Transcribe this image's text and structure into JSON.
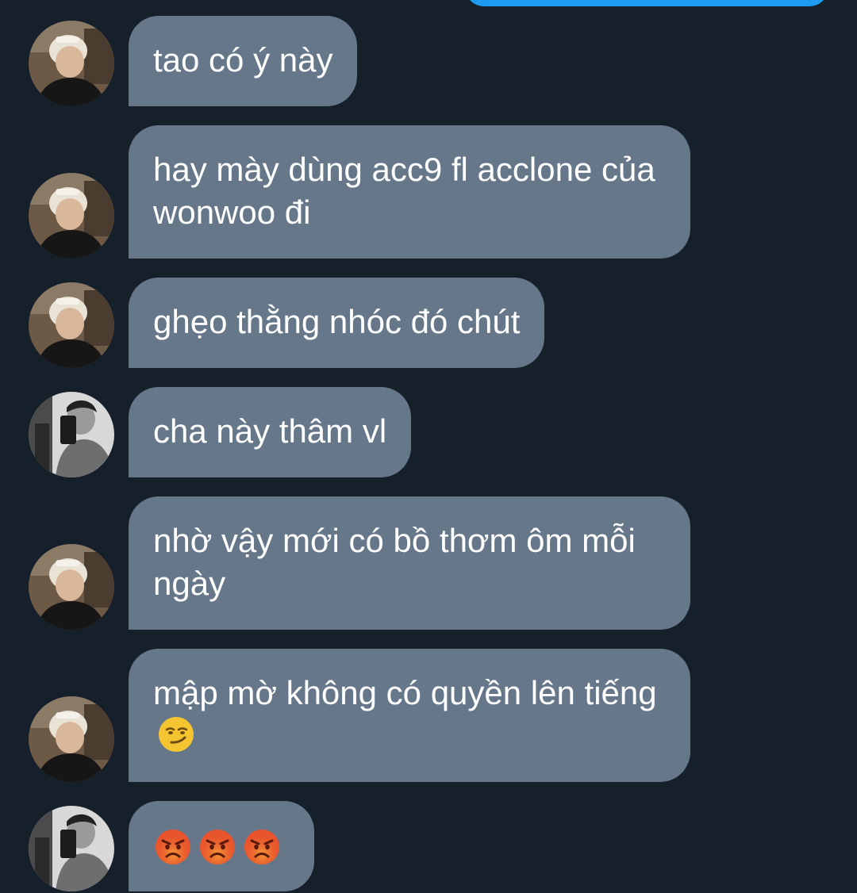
{
  "colors": {
    "background": "#16202b",
    "received_bubble": "#66778a",
    "sent_bubble": "#1d9bf0",
    "text": "#ffffff"
  },
  "messages": [
    {
      "sender": "blond-user",
      "text": "tao có ý này",
      "emoji": []
    },
    {
      "sender": "blond-user",
      "text": "hay mày dùng acc9 fl acclone của wonwoo đi",
      "emoji": []
    },
    {
      "sender": "blond-user",
      "text": "ghẹo thằng nhóc đó chút",
      "emoji": []
    },
    {
      "sender": "mono-user",
      "text": "cha này thâm vl",
      "emoji": []
    },
    {
      "sender": "blond-user",
      "text": "nhờ vậy mới có bồ thơm ôm mỗi ngày",
      "emoji": []
    },
    {
      "sender": "blond-user",
      "text": "mập mờ không có quyền lên tiếng",
      "emoji": [
        "smirking-face-emoji"
      ]
    },
    {
      "sender": "mono-user",
      "text": "",
      "emoji": [
        "pouting-face-emoji",
        "pouting-face-emoji",
        "pouting-face-emoji"
      ]
    }
  ]
}
